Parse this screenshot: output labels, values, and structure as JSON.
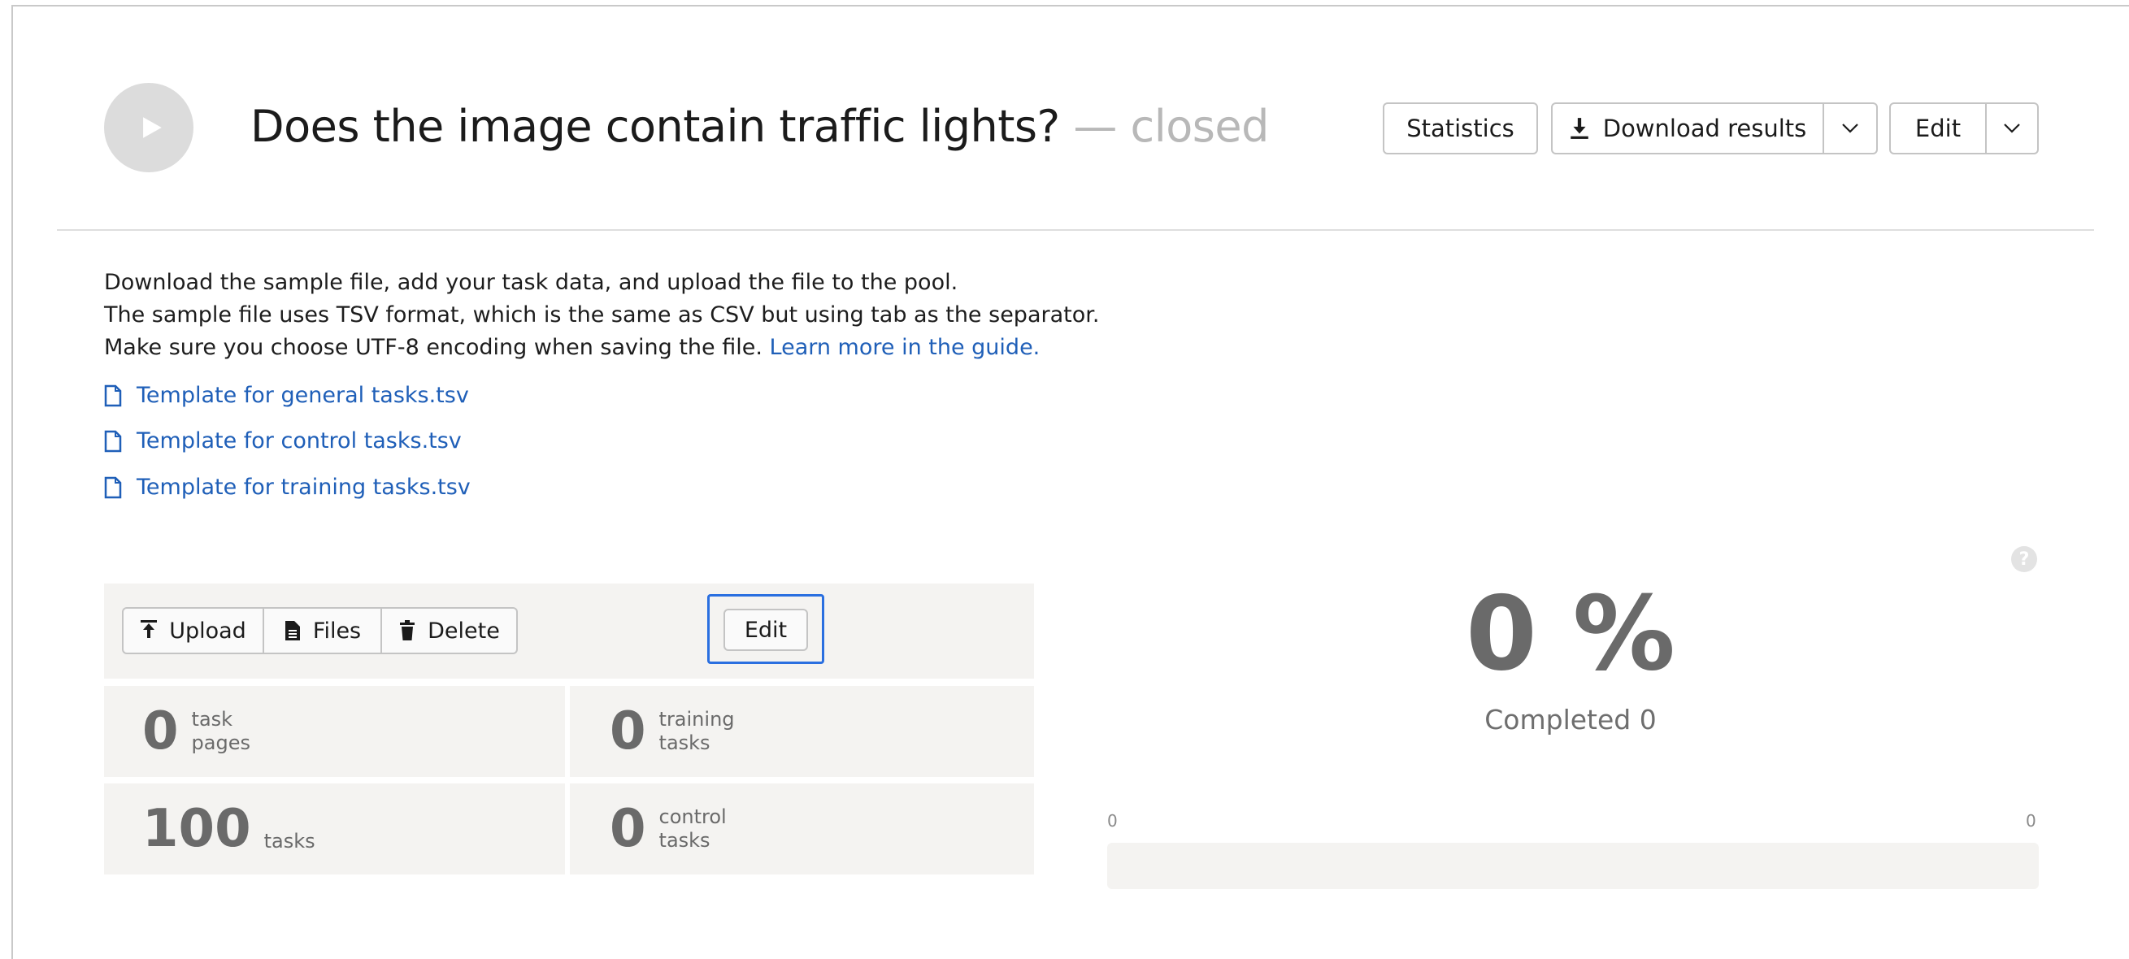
{
  "header": {
    "title": "Does the image contain traffic lights?",
    "status": " — closed",
    "buttons": {
      "statistics": "Statistics",
      "download_results": "Download results",
      "edit": "Edit"
    }
  },
  "instructions": {
    "line1": "Download the sample file, add your task data, and upload the file to the pool.",
    "line2": "The sample file uses TSV format, which is the same as CSV but using tab as the separator.",
    "line3": "Make sure you choose UTF-8 encoding when saving the file.",
    "guide_link": "Learn more in the guide."
  },
  "templates": [
    {
      "label": "Template for general tasks.tsv"
    },
    {
      "label": "Template for control tasks.tsv"
    },
    {
      "label": "Template for training tasks.tsv"
    }
  ],
  "toolbar": {
    "upload": "Upload",
    "files": "Files",
    "delete": "Delete",
    "edit": "Edit"
  },
  "stats": {
    "task_pages": {
      "value": "0",
      "label_top": "task",
      "label_bottom": "pages"
    },
    "training_tasks": {
      "value": "0",
      "label_top": "training",
      "label_bottom": "tasks"
    },
    "tasks": {
      "value": "100",
      "label": "tasks"
    },
    "control_tasks": {
      "value": "0",
      "label_top": "control",
      "label_bottom": "tasks"
    }
  },
  "progress": {
    "percent_text": "0 %",
    "completed_text": "Completed 0",
    "min_label": "0",
    "max_label": "0",
    "fraction": 0
  },
  "icons": {
    "play": "play-icon",
    "download": "download-icon",
    "chevron": "chevron-down-icon",
    "file": "file-icon",
    "upload": "upload-icon",
    "files": "files-icon",
    "delete": "trash-icon",
    "help": "help-icon"
  },
  "colors": {
    "link": "#1f5fb8",
    "focus": "#2a6fe0",
    "panel_bg": "#f4f3f1",
    "stat_text": "#6a6a6a"
  }
}
